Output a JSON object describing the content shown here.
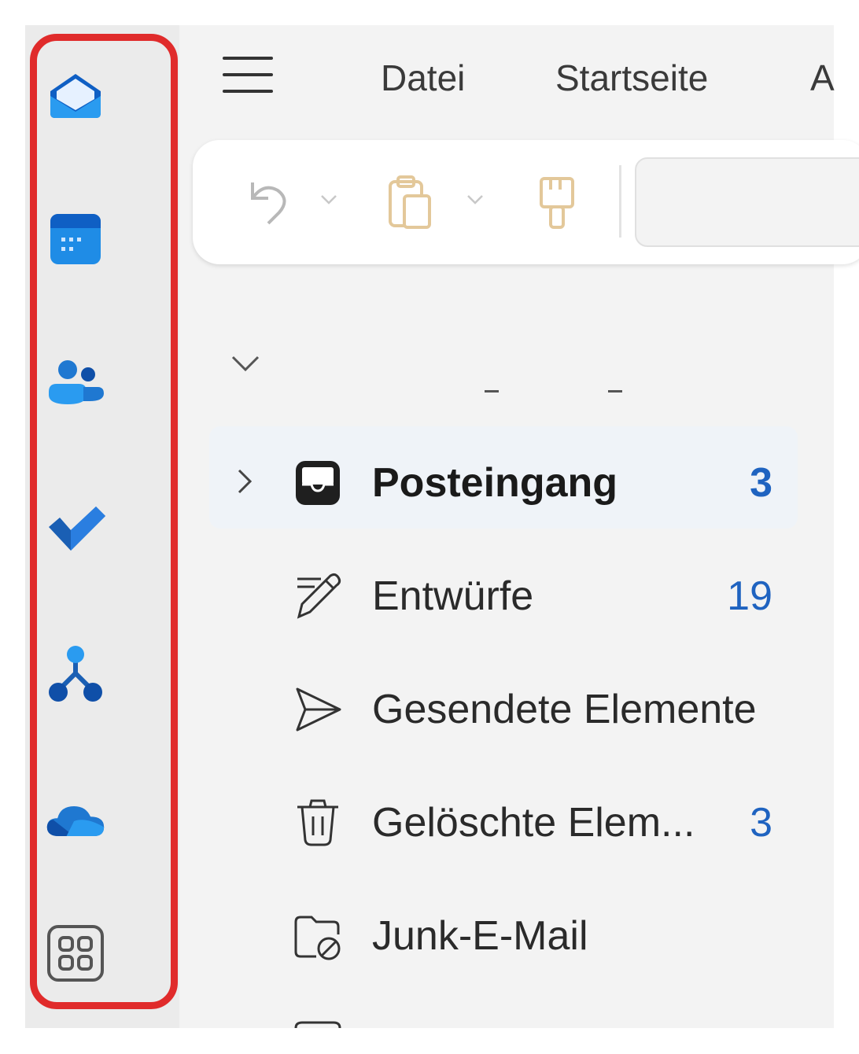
{
  "menu": {
    "tabs": [
      "Datei",
      "Startseite",
      "A"
    ]
  },
  "rail": {
    "items": [
      {
        "name": "mail",
        "icon": "mail-icon",
        "color": "#1f78d1"
      },
      {
        "name": "calendar",
        "icon": "calendar-icon",
        "color": "#1f9ae0"
      },
      {
        "name": "people",
        "icon": "people-icon",
        "color": "#1f78d1"
      },
      {
        "name": "todo",
        "icon": "checkmark-icon",
        "color": "#1a5fb4"
      },
      {
        "name": "org",
        "icon": "org-chart-icon",
        "color": "#1a5fb4"
      },
      {
        "name": "onedrive",
        "icon": "cloud-icon",
        "color": "#1f78d1"
      },
      {
        "name": "apps",
        "icon": "apps-grid-icon",
        "color": "#555555"
      }
    ]
  },
  "toolbar": {
    "undo_icon": "undo-icon",
    "paste_icon": "clipboard-icon",
    "format_icon": "format-painter-icon"
  },
  "folders": [
    {
      "name": "Posteingang",
      "count": "3",
      "icon": "inbox-icon",
      "selected": true
    },
    {
      "name": "Entwürfe",
      "count": "19",
      "icon": "drafts-icon"
    },
    {
      "name": "Gesendete Elemente",
      "count": "",
      "icon": "sent-icon"
    },
    {
      "name": "Gelöschte Elem...",
      "count": "3",
      "icon": "trash-icon"
    },
    {
      "name": "Junk-E-Mail",
      "count": "",
      "icon": "junk-icon"
    }
  ],
  "colors": {
    "accent": "#1f63c0",
    "highlight": "#e02b2b"
  }
}
